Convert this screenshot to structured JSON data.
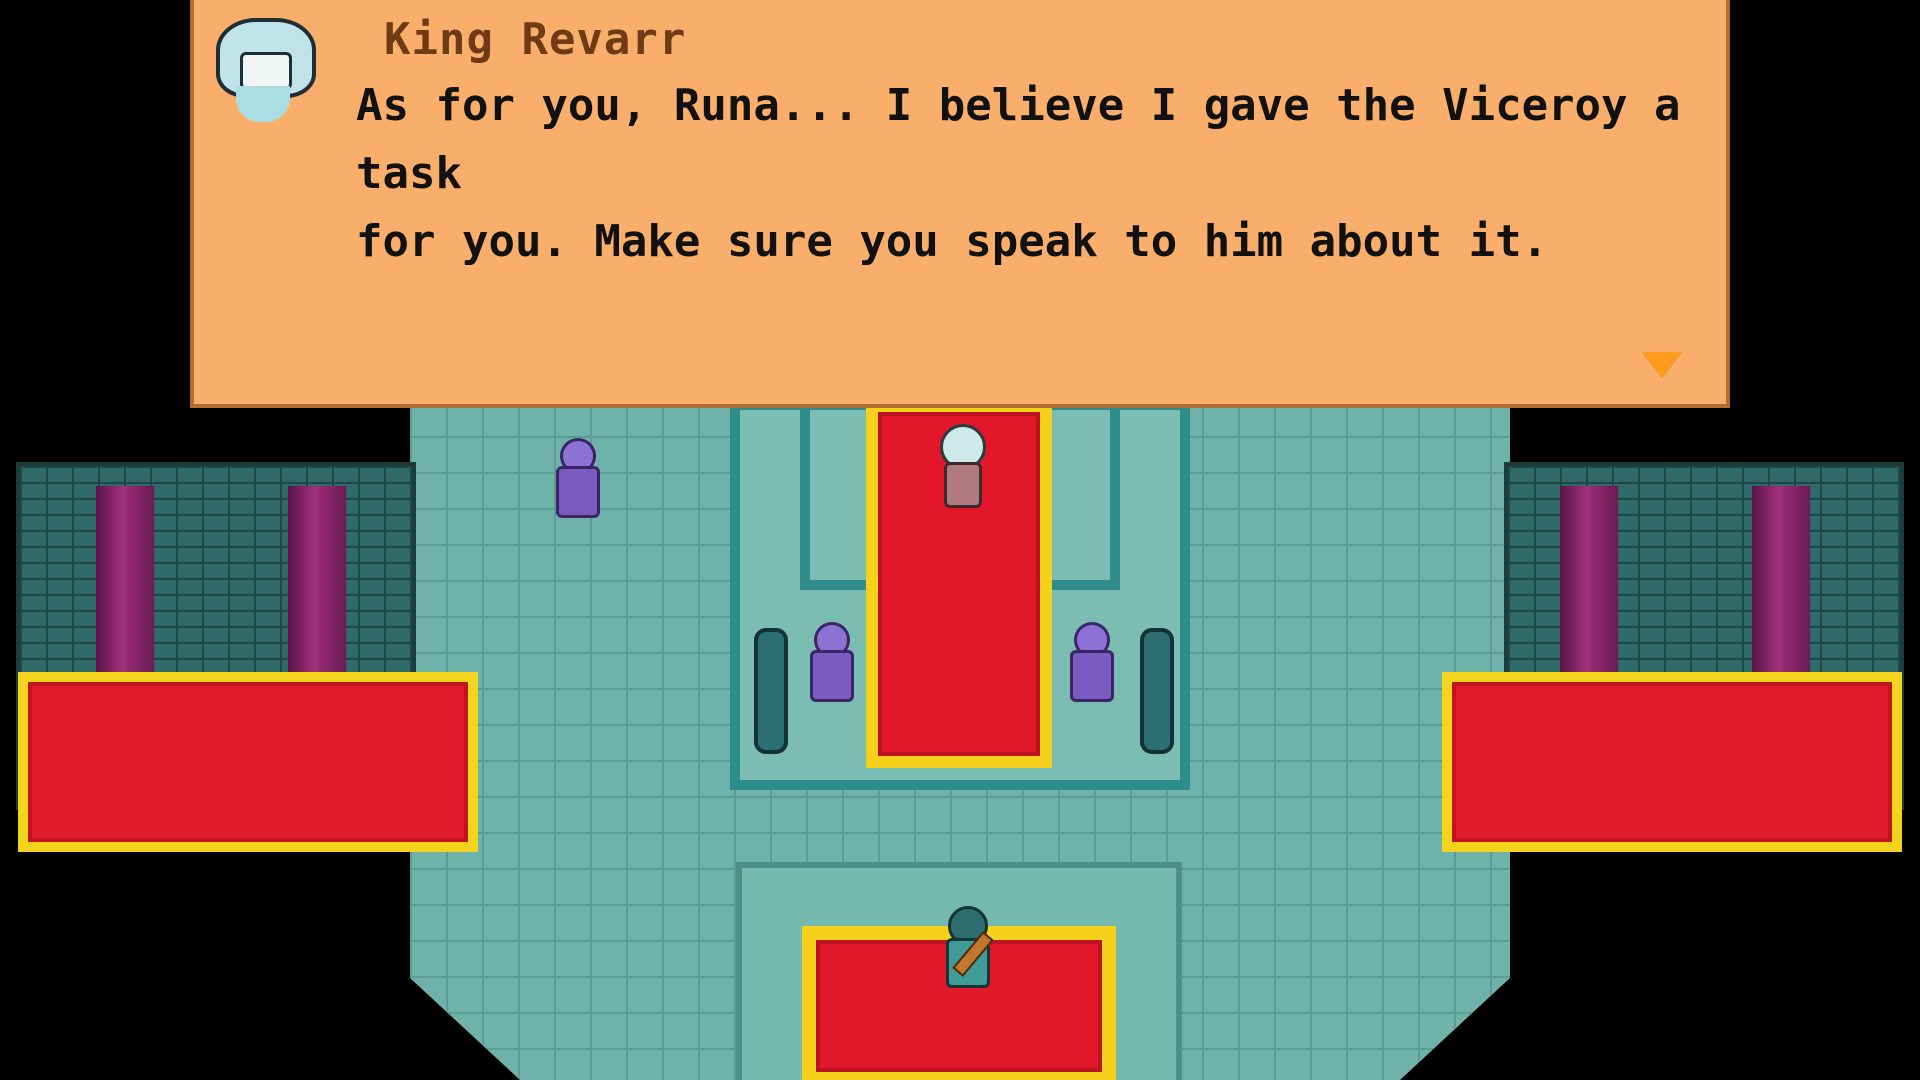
{
  "game": {
    "scene": "throne_room",
    "dialog": {
      "speaker": "King Revarr",
      "lines": [
        "As for you, Runa... I believe I gave the Viceroy a task",
        "for you. Make sure you speak to him about it."
      ],
      "portrait": "king-revarr-portrait",
      "continue_icon": "continue-arrow-icon"
    },
    "colors": {
      "dialog_bg": "#f9ae6b",
      "speaker_text": "#6e3b14",
      "carpet_red": "#e3172a",
      "carpet_trim": "#f5d11c",
      "floor": "#6fb2aa"
    }
  }
}
